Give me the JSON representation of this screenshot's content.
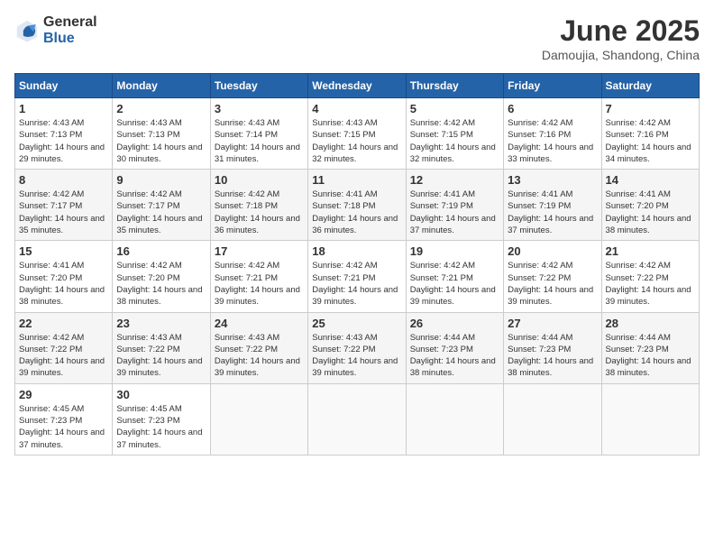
{
  "logo": {
    "general": "General",
    "blue": "Blue"
  },
  "title": "June 2025",
  "location": "Damoujia, Shandong, China",
  "weekdays": [
    "Sunday",
    "Monday",
    "Tuesday",
    "Wednesday",
    "Thursday",
    "Friday",
    "Saturday"
  ],
  "weeks": [
    [
      {
        "day": "1",
        "sunrise": "4:43 AM",
        "sunset": "7:13 PM",
        "daylight": "14 hours and 29 minutes."
      },
      {
        "day": "2",
        "sunrise": "4:43 AM",
        "sunset": "7:13 PM",
        "daylight": "14 hours and 30 minutes."
      },
      {
        "day": "3",
        "sunrise": "4:43 AM",
        "sunset": "7:14 PM",
        "daylight": "14 hours and 31 minutes."
      },
      {
        "day": "4",
        "sunrise": "4:43 AM",
        "sunset": "7:15 PM",
        "daylight": "14 hours and 32 minutes."
      },
      {
        "day": "5",
        "sunrise": "4:42 AM",
        "sunset": "7:15 PM",
        "daylight": "14 hours and 32 minutes."
      },
      {
        "day": "6",
        "sunrise": "4:42 AM",
        "sunset": "7:16 PM",
        "daylight": "14 hours and 33 minutes."
      },
      {
        "day": "7",
        "sunrise": "4:42 AM",
        "sunset": "7:16 PM",
        "daylight": "14 hours and 34 minutes."
      }
    ],
    [
      {
        "day": "8",
        "sunrise": "4:42 AM",
        "sunset": "7:17 PM",
        "daylight": "14 hours and 35 minutes."
      },
      {
        "day": "9",
        "sunrise": "4:42 AM",
        "sunset": "7:17 PM",
        "daylight": "14 hours and 35 minutes."
      },
      {
        "day": "10",
        "sunrise": "4:42 AM",
        "sunset": "7:18 PM",
        "daylight": "14 hours and 36 minutes."
      },
      {
        "day": "11",
        "sunrise": "4:41 AM",
        "sunset": "7:18 PM",
        "daylight": "14 hours and 36 minutes."
      },
      {
        "day": "12",
        "sunrise": "4:41 AM",
        "sunset": "7:19 PM",
        "daylight": "14 hours and 37 minutes."
      },
      {
        "day": "13",
        "sunrise": "4:41 AM",
        "sunset": "7:19 PM",
        "daylight": "14 hours and 37 minutes."
      },
      {
        "day": "14",
        "sunrise": "4:41 AM",
        "sunset": "7:20 PM",
        "daylight": "14 hours and 38 minutes."
      }
    ],
    [
      {
        "day": "15",
        "sunrise": "4:41 AM",
        "sunset": "7:20 PM",
        "daylight": "14 hours and 38 minutes."
      },
      {
        "day": "16",
        "sunrise": "4:42 AM",
        "sunset": "7:20 PM",
        "daylight": "14 hours and 38 minutes."
      },
      {
        "day": "17",
        "sunrise": "4:42 AM",
        "sunset": "7:21 PM",
        "daylight": "14 hours and 39 minutes."
      },
      {
        "day": "18",
        "sunrise": "4:42 AM",
        "sunset": "7:21 PM",
        "daylight": "14 hours and 39 minutes."
      },
      {
        "day": "19",
        "sunrise": "4:42 AM",
        "sunset": "7:21 PM",
        "daylight": "14 hours and 39 minutes."
      },
      {
        "day": "20",
        "sunrise": "4:42 AM",
        "sunset": "7:22 PM",
        "daylight": "14 hours and 39 minutes."
      },
      {
        "day": "21",
        "sunrise": "4:42 AM",
        "sunset": "7:22 PM",
        "daylight": "14 hours and 39 minutes."
      }
    ],
    [
      {
        "day": "22",
        "sunrise": "4:42 AM",
        "sunset": "7:22 PM",
        "daylight": "14 hours and 39 minutes."
      },
      {
        "day": "23",
        "sunrise": "4:43 AM",
        "sunset": "7:22 PM",
        "daylight": "14 hours and 39 minutes."
      },
      {
        "day": "24",
        "sunrise": "4:43 AM",
        "sunset": "7:22 PM",
        "daylight": "14 hours and 39 minutes."
      },
      {
        "day": "25",
        "sunrise": "4:43 AM",
        "sunset": "7:22 PM",
        "daylight": "14 hours and 39 minutes."
      },
      {
        "day": "26",
        "sunrise": "4:44 AM",
        "sunset": "7:23 PM",
        "daylight": "14 hours and 38 minutes."
      },
      {
        "day": "27",
        "sunrise": "4:44 AM",
        "sunset": "7:23 PM",
        "daylight": "14 hours and 38 minutes."
      },
      {
        "day": "28",
        "sunrise": "4:44 AM",
        "sunset": "7:23 PM",
        "daylight": "14 hours and 38 minutes."
      }
    ],
    [
      {
        "day": "29",
        "sunrise": "4:45 AM",
        "sunset": "7:23 PM",
        "daylight": "14 hours and 37 minutes."
      },
      {
        "day": "30",
        "sunrise": "4:45 AM",
        "sunset": "7:23 PM",
        "daylight": "14 hours and 37 minutes."
      },
      null,
      null,
      null,
      null,
      null
    ]
  ]
}
